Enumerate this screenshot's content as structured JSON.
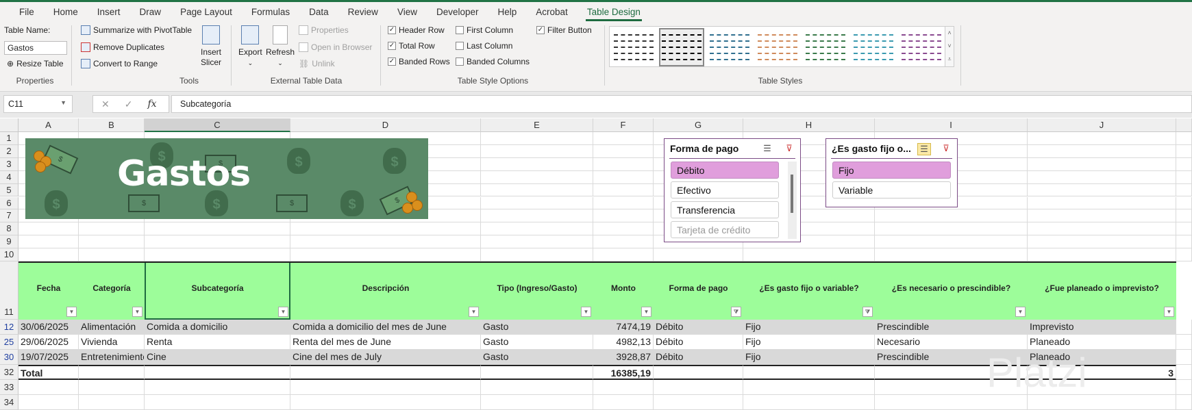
{
  "tabs": [
    "File",
    "Home",
    "Insert",
    "Draw",
    "Page Layout",
    "Formulas",
    "Data",
    "Review",
    "View",
    "Developer",
    "Help",
    "Acrobat",
    "Table Design"
  ],
  "active_tab": "Table Design",
  "ribbon": {
    "properties": {
      "table_name_label": "Table Name:",
      "table_name": "Gastos",
      "resize": "Resize Table",
      "group": "Properties"
    },
    "tools": {
      "pivot": "Summarize with PivotTable",
      "dupes": "Remove Duplicates",
      "convert": "Convert to Range",
      "slicer": "Insert Slicer",
      "group": "Tools"
    },
    "external": {
      "export": "Export",
      "refresh": "Refresh",
      "properties": "Properties",
      "open_browser": "Open in Browser",
      "unlink": "Unlink",
      "group": "External Table Data"
    },
    "options": {
      "header_row": "Header Row",
      "total_row": "Total Row",
      "banded_rows": "Banded Rows",
      "first_column": "First Column",
      "last_column": "Last Column",
      "banded_columns": "Banded Columns",
      "filter_button": "Filter Button",
      "group": "Table Style Options",
      "checked": {
        "header_row": true,
        "total_row": true,
        "banded_rows": true,
        "first_column": false,
        "last_column": false,
        "banded_columns": false,
        "filter_button": true
      }
    },
    "styles": {
      "group": "Table Styles",
      "swatch_colors": [
        "#333333",
        "#000000",
        "#2f6f8f",
        "#d08a5a",
        "#3a7a4a",
        "#3a9ab0",
        "#8a4a90"
      ]
    }
  },
  "formula_bar": {
    "name_box": "C11",
    "formula": "Subcategoría"
  },
  "columns": [
    "A",
    "B",
    "C",
    "D",
    "E",
    "F",
    "G",
    "H",
    "I",
    "J"
  ],
  "selected_column": "C",
  "row_numbers": [
    "1",
    "2",
    "3",
    "4",
    "5",
    "6",
    "7",
    "8",
    "9",
    "10",
    "11",
    "12",
    "25",
    "30",
    "32",
    "33",
    "34"
  ],
  "banner": {
    "title": "Gastos"
  },
  "table": {
    "headers": [
      "Fecha",
      "Categoría",
      "Subcategoría",
      "Descripción",
      "Tipo (Ingreso/Gasto)",
      "Monto",
      "Forma de pago",
      "¿Es gasto fijo o variable?",
      "¿Es necesario o prescindible?",
      "¿Fue planeado o imprevisto?"
    ],
    "filtered_columns": [
      6,
      7
    ],
    "rows": [
      [
        "30/06/2025",
        "Alimentación",
        "Comida a domicilio",
        "Comida a domicilio del mes de June",
        "Gasto",
        "7474,19",
        "Débito",
        "Fijo",
        "Prescindible",
        "Imprevisto"
      ],
      [
        "29/06/2025",
        "Vivienda",
        "Renta",
        "Renta del mes de June",
        "Gasto",
        "4982,13",
        "Débito",
        "Fijo",
        "Necesario",
        "Planeado"
      ],
      [
        "19/07/2025",
        "Entretenimiento",
        "Cine",
        "Cine del mes de July",
        "Gasto",
        "3928,87",
        "Débito",
        "Fijo",
        "Prescindible",
        "Planeado"
      ]
    ],
    "total_label": "Total",
    "total_monto": "16385,19",
    "total_count": "3"
  },
  "slicers": [
    {
      "title": "Forma de pago",
      "items": [
        {
          "label": "Débito",
          "selected": true
        },
        {
          "label": "Efectivo"
        },
        {
          "label": "Transferencia"
        },
        {
          "label": "Tarjeta de crédito",
          "dim": true
        }
      ]
    },
    {
      "title": "¿Es gasto fijo o...",
      "items": [
        {
          "label": "Fijo",
          "selected": true
        },
        {
          "label": "Variable"
        }
      ]
    }
  ],
  "watermark": "Platzi"
}
